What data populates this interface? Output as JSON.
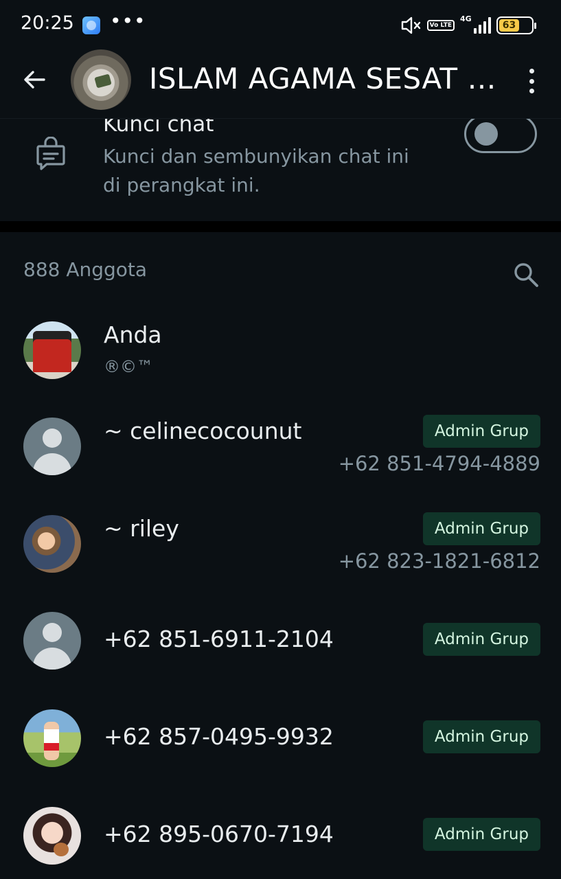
{
  "status_bar": {
    "time": "20:25",
    "dots": "•••",
    "network": "4G",
    "volte": "Vo LTE",
    "battery": "63"
  },
  "header": {
    "title": "ISLAM AGAMA SESAT DI INDONESIA"
  },
  "lock_chat": {
    "title": "Kunci chat",
    "description": "Kunci dan sembunyikan chat ini di perangkat ini.",
    "enabled": false
  },
  "members": {
    "count_label": "888 Anggota",
    "list": [
      {
        "name": "Anda",
        "subtitle": "®©™",
        "badge": "",
        "phone": ""
      },
      {
        "name": "~ celinecocounut",
        "subtitle": "",
        "badge": "Admin Grup",
        "phone": "+62 851-4794-4889"
      },
      {
        "name": "~ riley",
        "subtitle": "",
        "badge": "Admin Grup",
        "phone": "+62 823-1821-6812"
      },
      {
        "name": "+62 851-6911-2104",
        "subtitle": "",
        "badge": "Admin Grup",
        "phone": ""
      },
      {
        "name": "+62 857-0495-9932",
        "subtitle": "",
        "badge": "Admin Grup",
        "phone": ""
      },
      {
        "name": "+62 895-0670-7194",
        "subtitle": "",
        "badge": "Admin Grup",
        "phone": ""
      }
    ]
  },
  "icons": {
    "back": "arrow-left-icon",
    "menu": "more-vertical-icon",
    "lock_chat": "chat-lock-icon",
    "search": "search-icon"
  }
}
